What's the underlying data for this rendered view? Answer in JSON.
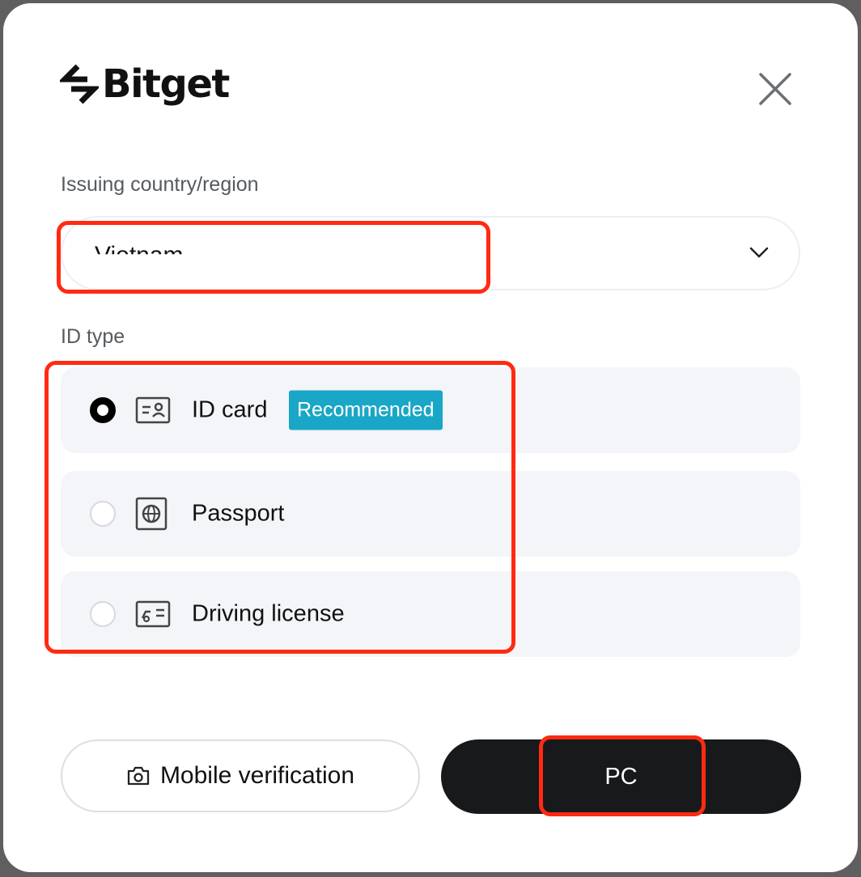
{
  "brand": {
    "name": "Bitget"
  },
  "country": {
    "label": "Issuing country/region",
    "value": "Vietnam",
    "chevron_icon": "chevron-down-icon"
  },
  "id_type": {
    "label": "ID type",
    "options": [
      {
        "label": "ID card",
        "icon": "id-card-icon",
        "selected": true,
        "badge": "Recommended"
      },
      {
        "label": "Passport",
        "icon": "passport-icon",
        "selected": false
      },
      {
        "label": "Driving license",
        "icon": "driving-license-icon",
        "selected": false
      }
    ]
  },
  "actions": {
    "mobile_label": "Mobile verification",
    "mobile_icon": "camera-icon",
    "pc_label": "PC"
  },
  "colors": {
    "badge": "#1aa6c6",
    "primary_button": "#18191b",
    "annotation": "#ff2a12",
    "row_background": "#f3f5f8"
  }
}
